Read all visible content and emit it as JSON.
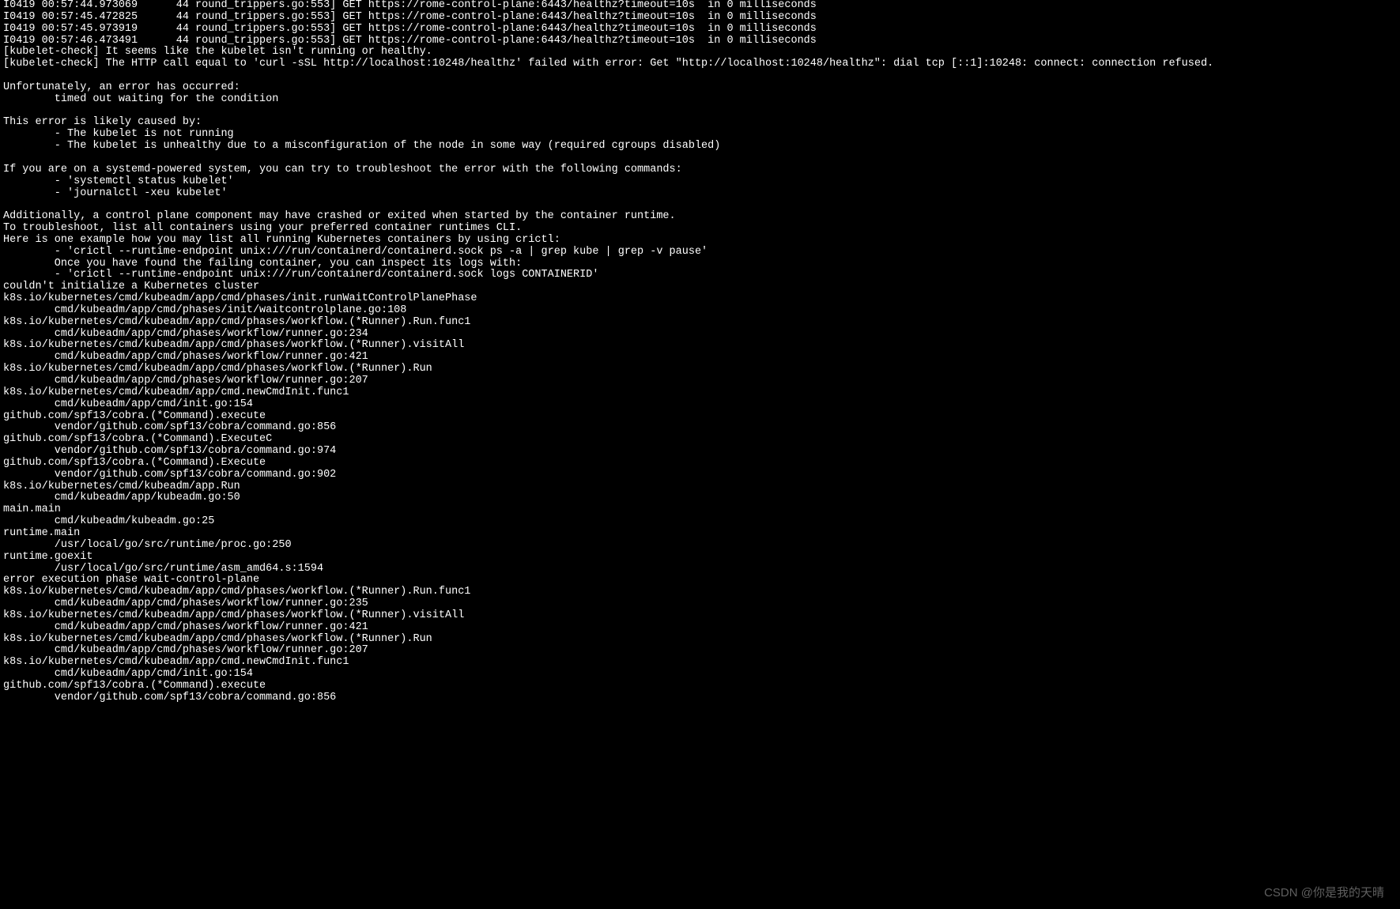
{
  "terminal": {
    "lines": [
      "I0419 00:57:44.973069      44 round_trippers.go:553] GET https://rome-control-plane:6443/healthz?timeout=10s  in 0 milliseconds",
      "I0419 00:57:45.472825      44 round_trippers.go:553] GET https://rome-control-plane:6443/healthz?timeout=10s  in 0 milliseconds",
      "I0419 00:57:45.973919      44 round_trippers.go:553] GET https://rome-control-plane:6443/healthz?timeout=10s  in 0 milliseconds",
      "I0419 00:57:46.473491      44 round_trippers.go:553] GET https://rome-control-plane:6443/healthz?timeout=10s  in 0 milliseconds",
      "[kubelet-check] It seems like the kubelet isn't running or healthy.",
      "[kubelet-check] The HTTP call equal to 'curl -sSL http://localhost:10248/healthz' failed with error: Get \"http://localhost:10248/healthz\": dial tcp [::1]:10248: connect: connection refused.",
      "",
      "Unfortunately, an error has occurred:",
      "        timed out waiting for the condition",
      "",
      "This error is likely caused by:",
      "        - The kubelet is not running",
      "        - The kubelet is unhealthy due to a misconfiguration of the node in some way (required cgroups disabled)",
      "",
      "If you are on a systemd-powered system, you can try to troubleshoot the error with the following commands:",
      "        - 'systemctl status kubelet'",
      "        - 'journalctl -xeu kubelet'",
      "",
      "Additionally, a control plane component may have crashed or exited when started by the container runtime.",
      "To troubleshoot, list all containers using your preferred container runtimes CLI.",
      "Here is one example how you may list all running Kubernetes containers by using crictl:",
      "        - 'crictl --runtime-endpoint unix:///run/containerd/containerd.sock ps -a | grep kube | grep -v pause'",
      "        Once you have found the failing container, you can inspect its logs with:",
      "        - 'crictl --runtime-endpoint unix:///run/containerd/containerd.sock logs CONTAINERID'",
      "couldn't initialize a Kubernetes cluster",
      "k8s.io/kubernetes/cmd/kubeadm/app/cmd/phases/init.runWaitControlPlanePhase",
      "        cmd/kubeadm/app/cmd/phases/init/waitcontrolplane.go:108",
      "k8s.io/kubernetes/cmd/kubeadm/app/cmd/phases/workflow.(*Runner).Run.func1",
      "        cmd/kubeadm/app/cmd/phases/workflow/runner.go:234",
      "k8s.io/kubernetes/cmd/kubeadm/app/cmd/phases/workflow.(*Runner).visitAll",
      "        cmd/kubeadm/app/cmd/phases/workflow/runner.go:421",
      "k8s.io/kubernetes/cmd/kubeadm/app/cmd/phases/workflow.(*Runner).Run",
      "        cmd/kubeadm/app/cmd/phases/workflow/runner.go:207",
      "k8s.io/kubernetes/cmd/kubeadm/app/cmd.newCmdInit.func1",
      "        cmd/kubeadm/app/cmd/init.go:154",
      "github.com/spf13/cobra.(*Command).execute",
      "        vendor/github.com/spf13/cobra/command.go:856",
      "github.com/spf13/cobra.(*Command).ExecuteC",
      "        vendor/github.com/spf13/cobra/command.go:974",
      "github.com/spf13/cobra.(*Command).Execute",
      "        vendor/github.com/spf13/cobra/command.go:902",
      "k8s.io/kubernetes/cmd/kubeadm/app.Run",
      "        cmd/kubeadm/app/kubeadm.go:50",
      "main.main",
      "        cmd/kubeadm/kubeadm.go:25",
      "runtime.main",
      "        /usr/local/go/src/runtime/proc.go:250",
      "runtime.goexit",
      "        /usr/local/go/src/runtime/asm_amd64.s:1594",
      "error execution phase wait-control-plane",
      "k8s.io/kubernetes/cmd/kubeadm/app/cmd/phases/workflow.(*Runner).Run.func1",
      "        cmd/kubeadm/app/cmd/phases/workflow/runner.go:235",
      "k8s.io/kubernetes/cmd/kubeadm/app/cmd/phases/workflow.(*Runner).visitAll",
      "        cmd/kubeadm/app/cmd/phases/workflow/runner.go:421",
      "k8s.io/kubernetes/cmd/kubeadm/app/cmd/phases/workflow.(*Runner).Run",
      "        cmd/kubeadm/app/cmd/phases/workflow/runner.go:207",
      "k8s.io/kubernetes/cmd/kubeadm/app/cmd.newCmdInit.func1",
      "        cmd/kubeadm/app/cmd/init.go:154",
      "github.com/spf13/cobra.(*Command).execute",
      "        vendor/github.com/spf13/cobra/command.go:856"
    ]
  },
  "watermark": "CSDN @你是我的天晴"
}
